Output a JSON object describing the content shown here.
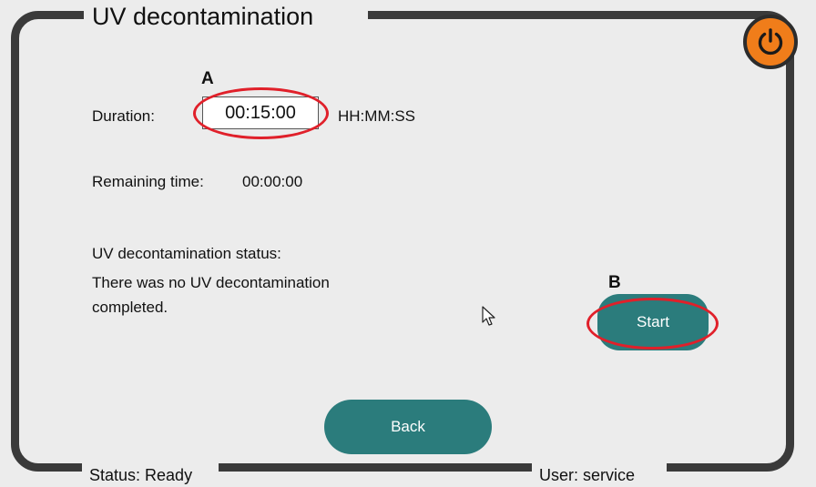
{
  "window": {
    "title": "UV decontamination"
  },
  "duration": {
    "label": "Duration:",
    "value": "00:15:00",
    "unit": "HH:MM:SS"
  },
  "remaining": {
    "label": "Remaining time:",
    "value": "00:00:00"
  },
  "decon_status": {
    "label": "UV decontamination status:",
    "message_line1": "There was no UV decontamination",
    "message_line2": "completed."
  },
  "annotations": {
    "a": "A",
    "b": "B",
    "highlight_color": "#e0202a"
  },
  "buttons": {
    "start": "Start",
    "back": "Back",
    "power_icon": "power-icon"
  },
  "statusbar": {
    "status": "Status: Ready",
    "user": "User: service"
  },
  "colors": {
    "accent": "#2b7c7c",
    "power": "#f07d1a",
    "frame": "#3a3a3a"
  }
}
